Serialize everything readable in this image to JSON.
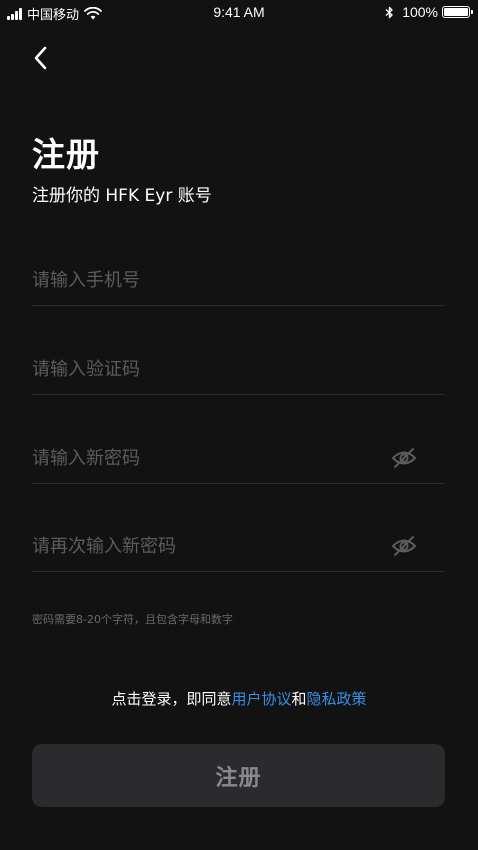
{
  "status_bar": {
    "carrier": "中国移动",
    "time": "9:41 AM",
    "battery": "100%"
  },
  "header": {
    "title": "注册",
    "subtitle": "注册你的 HFK Eyr 账号"
  },
  "form": {
    "phone": {
      "placeholder": "请输入手机号",
      "value": ""
    },
    "code": {
      "placeholder": "请输入验证码",
      "value": ""
    },
    "password": {
      "placeholder": "请输入新密码",
      "value": ""
    },
    "confirm_password": {
      "placeholder": "请再次输入新密码",
      "value": ""
    },
    "hint": "密码需要8-20个字符，且包含字母和数字"
  },
  "agreement": {
    "prefix": "点击登录，即同意",
    "user_agreement": "用户协议",
    "and": "和",
    "privacy_policy": "隐私政策"
  },
  "actions": {
    "register_label": "注册"
  },
  "colors": {
    "background": "#121212",
    "link": "#3a8ee6",
    "button_bg": "#2b2b2d",
    "placeholder": "#5c5c5c"
  }
}
